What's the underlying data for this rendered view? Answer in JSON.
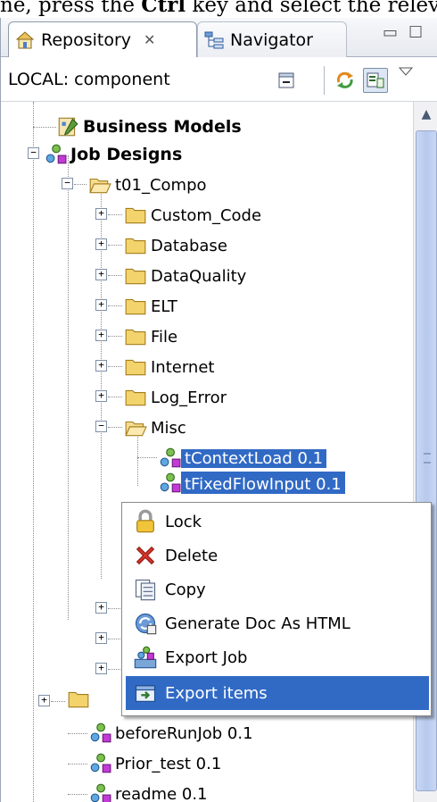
{
  "instruction": {
    "prefix": "ne, press the ",
    "key": "Ctrl",
    "suffix": " key and select the relevant i"
  },
  "tabs": [
    {
      "label": "Repository",
      "close": "✕"
    },
    {
      "label": "Navigator"
    }
  ],
  "toolbar": {
    "label": "LOCAL: component"
  },
  "tree": {
    "business_models": "Business Models",
    "job_designs": "Job Designs",
    "t01": "t01_Compo",
    "folders": [
      "Custom_Code",
      "Database",
      "DataQuality",
      "ELT",
      "File",
      "Internet",
      "Log_Error",
      "Misc"
    ],
    "misc_items": [
      "tContextLoad 0.1",
      "tFixedFlowInput 0.1"
    ],
    "jobs": [
      "beforeRunJob 0.1",
      "Prior_test 0.1",
      "readme 0.1"
    ]
  },
  "context_menu": {
    "items": [
      "Lock",
      "Delete",
      "Copy",
      "Generate Doc As HTML",
      "Export Job",
      "Export items"
    ],
    "highlighted": "Export items"
  },
  "colors": {
    "selection": "#316ac5",
    "folder": "#f3d36b"
  }
}
